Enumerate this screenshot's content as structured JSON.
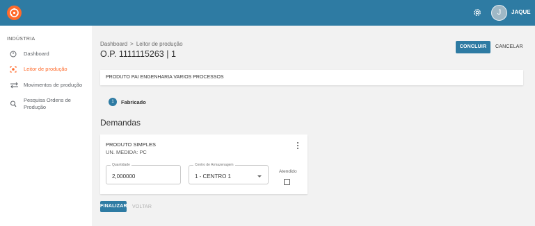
{
  "topbar": {
    "username": "JAQUE",
    "avatar_initial": "J"
  },
  "sidebar": {
    "section_title": "INDÚSTRIA",
    "items": [
      {
        "label": "Dashboard",
        "icon": "dashboard-gauge-icon"
      },
      {
        "label": "Leitor de produção",
        "icon": "scanner-icon",
        "active": true
      },
      {
        "label": "Movimentos de produção",
        "icon": "swap-arrows-icon"
      },
      {
        "label": "Pesquisa Ordens de Produção",
        "icon": "search-icon"
      }
    ]
  },
  "header": {
    "breadcrumb": [
      "Dashboard",
      "Leitor de produção"
    ],
    "breadcrumb_separator": ">",
    "title": "O.P. 1111115263 | 1",
    "concluir_label": "CONCLUIR",
    "cancelar_label": "CANCELAR"
  },
  "product": {
    "name": "PRODUTO PAI ENGENHARIA VARIOS PROCESSOS"
  },
  "step": {
    "number": "1",
    "label": "Fabricado"
  },
  "demandas": {
    "title": "Demandas",
    "item": {
      "name": "PRODUTO SIMPLES",
      "unit": "UN. MEDIDA: PC",
      "quantity_label": "Quantidade",
      "quantity_value": "2,000000",
      "warehouse_label": "Centro de Armazenagem",
      "warehouse_value": "1 - CENTRO 1",
      "atendido_label": "Atendido",
      "atendido_checked": false
    }
  },
  "actions": {
    "finalizar_label": "FINALIZAR",
    "voltar_label": "VOLTAR"
  },
  "colors": {
    "primary": "#2e7ba3",
    "accent": "#ff6a2b",
    "background": "#f2f2f2"
  }
}
